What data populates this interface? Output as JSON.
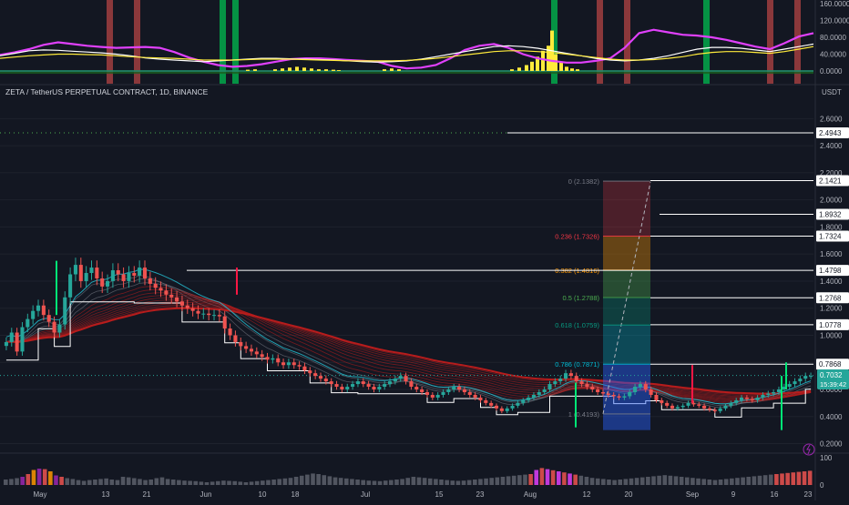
{
  "header": {
    "symbol_title": "ZETA / TetherUS PERPETUAL CONTRACT, 1D, BINANCE",
    "currency": "USDT",
    "current_price": "0.7032",
    "countdown": "15:39:42"
  },
  "colors": {
    "background": "#131722",
    "up_candle": "#26a69a",
    "down_candle": "#ef5350",
    "ribbon": "#b71c1c",
    "oscillator_fast": "#e040fb",
    "oscillator_slow": "#ffeb3b",
    "accent": "#2962ff"
  },
  "chart_data": [
    {
      "type": "oscillator",
      "y_ticks": [
        "160.0000",
        "120.0000",
        "80.0000",
        "40.0000",
        "0.0000"
      ],
      "ylim": [
        0,
        160
      ],
      "series": [
        {
          "values": [
            38,
            44,
            52,
            62,
            68,
            64,
            60,
            57,
            55,
            56,
            57,
            55,
            45,
            32,
            22,
            14,
            10,
            12,
            16,
            22,
            28,
            30,
            30,
            28,
            26,
            24,
            22,
            12,
            6,
            8,
            14,
            30,
            50,
            60,
            64,
            55,
            40,
            30,
            24,
            20,
            20,
            24,
            30,
            55,
            90,
            98,
            92,
            86,
            84,
            80,
            74,
            66,
            58,
            52,
            66,
            82,
            90
          ]
        },
        {
          "values": [
            36,
            42,
            48,
            50,
            49,
            47,
            45,
            43,
            40,
            36,
            31,
            28,
            26,
            24,
            22,
            24,
            26,
            28,
            30,
            30,
            29,
            28,
            27,
            26,
            24,
            22,
            21,
            22,
            24,
            28,
            34,
            40,
            46,
            52,
            58,
            60,
            58,
            54,
            48,
            42,
            36,
            30,
            26,
            24,
            26,
            30,
            36,
            44,
            52,
            56,
            56,
            54,
            50,
            46,
            52,
            58,
            64
          ]
        },
        {
          "values": [
            30,
            33,
            36,
            38,
            40,
            40,
            39,
            38,
            36,
            34,
            32,
            31,
            30,
            28,
            26,
            26,
            26,
            27,
            28,
            28,
            28,
            27,
            26,
            25,
            24,
            24,
            24,
            24,
            25,
            27,
            30,
            34,
            38,
            42,
            46,
            48,
            48,
            46,
            44,
            40,
            36,
            32,
            28,
            26,
            26,
            27,
            30,
            34,
            40,
            44,
            46,
            46,
            44,
            42,
            46,
            52,
            58
          ]
        }
      ]
    },
    {
      "type": "candlestick",
      "x_ticks": [
        "May",
        "13",
        "21",
        "Jun",
        "10",
        "18",
        "Jul",
        "15",
        "23",
        "Aug",
        "12",
        "20",
        "Sep",
        "9",
        "16",
        "23"
      ],
      "y_ticks": [
        "2.6000",
        "2.4000",
        "2.2000",
        "2.0000",
        "1.8000",
        "1.6000",
        "1.4000",
        "1.2000",
        "1.0000",
        "0.8000",
        "0.6000",
        "0.4000",
        "0.2000"
      ],
      "ylim": [
        0.15,
        2.75
      ],
      "close": [
        0.95,
        1.02,
        0.88,
        1.06,
        1.12,
        1.18,
        1.22,
        1.15,
        1.1,
        1.02,
        1.08,
        1.28,
        1.45,
        1.52,
        1.4,
        1.46,
        1.5,
        1.42,
        1.36,
        1.4,
        1.48,
        1.45,
        1.4,
        1.46,
        1.44,
        1.5,
        1.42,
        1.38,
        1.35,
        1.33,
        1.3,
        1.28,
        1.25,
        1.22,
        1.2,
        1.18,
        1.16,
        1.16,
        1.15,
        1.15,
        1.14,
        1.05,
        1.0,
        0.95,
        0.92,
        0.9,
        0.88,
        0.86,
        0.84,
        0.82,
        0.83,
        0.8,
        0.78,
        0.8,
        0.78,
        0.77,
        0.74,
        0.72,
        0.7,
        0.68,
        0.66,
        0.64,
        0.62,
        0.6,
        0.62,
        0.64,
        0.66,
        0.64,
        0.62,
        0.6,
        0.62,
        0.64,
        0.66,
        0.68,
        0.7,
        0.66,
        0.62,
        0.6,
        0.58,
        0.56,
        0.54,
        0.56,
        0.58,
        0.6,
        0.62,
        0.6,
        0.58,
        0.56,
        0.54,
        0.52,
        0.5,
        0.48,
        0.46,
        0.44,
        0.46,
        0.48,
        0.5,
        0.52,
        0.54,
        0.56,
        0.58,
        0.6,
        0.64,
        0.66,
        0.68,
        0.72,
        0.7,
        0.66,
        0.64,
        0.62,
        0.6,
        0.58,
        0.57,
        0.56,
        0.55,
        0.54,
        0.55,
        0.58,
        0.62,
        0.64,
        0.6,
        0.56,
        0.52,
        0.5,
        0.48,
        0.46,
        0.47,
        0.48,
        0.5,
        0.49,
        0.48,
        0.46,
        0.45,
        0.44,
        0.46,
        0.48,
        0.5,
        0.52,
        0.54,
        0.53,
        0.52,
        0.54,
        0.56,
        0.57,
        0.58,
        0.6,
        0.62,
        0.64,
        0.66,
        0.68,
        0.7,
        0.7
      ]
    },
    {
      "type": "bar",
      "ylim": [
        0,
        110
      ],
      "y_ticks": [
        "100",
        "0"
      ],
      "values": [
        20,
        22,
        25,
        30,
        40,
        55,
        60,
        58,
        50,
        35,
        30,
        25,
        22,
        18,
        15,
        18,
        20,
        22,
        24,
        20,
        18,
        30,
        28,
        25,
        22,
        18,
        20,
        25,
        28,
        22,
        20,
        18,
        16,
        15,
        14,
        12,
        10,
        12,
        14,
        16,
        15,
        14,
        12,
        10,
        12,
        14,
        16,
        18,
        20,
        22,
        24,
        26,
        30,
        34,
        38,
        42,
        40,
        36,
        32,
        28,
        26,
        24,
        22,
        20,
        18,
        16,
        15,
        14,
        16,
        18,
        20,
        22,
        26,
        30,
        28,
        26,
        24,
        22,
        20,
        18,
        16,
        15,
        16,
        18,
        20,
        22,
        24,
        26,
        28,
        30,
        32,
        34,
        36,
        38,
        40,
        55,
        62,
        58,
        54,
        50,
        46,
        42,
        38,
        34,
        30,
        26,
        24,
        22,
        20,
        18,
        20,
        22,
        24,
        26,
        28,
        30,
        32,
        34,
        36,
        34,
        32,
        30,
        28,
        26,
        24,
        22,
        20,
        18,
        20,
        22,
        24,
        26,
        28,
        30,
        32,
        34,
        36,
        38,
        40,
        42,
        44,
        46,
        48,
        50,
        52
      ]
    }
  ],
  "fib": {
    "levels": [
      {
        "label": "0 (2.1382)",
        "value": 2.1382,
        "color": "#787b86"
      },
      {
        "label": "0.236 (1.7326)",
        "value": 1.7326,
        "color": "#f23645"
      },
      {
        "label": "0.382 (1.4816)",
        "value": 1.4816,
        "color": "#ff9800"
      },
      {
        "label": "0.5 (1.2788)",
        "value": 1.2788,
        "color": "#4caf50"
      },
      {
        "label": "0.618 (1.0759)",
        "value": 1.0759,
        "color": "#089981"
      },
      {
        "label": "0.786 (0.7871)",
        "value": 0.7871,
        "color": "#00bcd4"
      },
      {
        "label": "1 (0.4193)",
        "value": 0.4193,
        "color": "#787b86"
      }
    ]
  },
  "price_tags": [
    {
      "label": "2.4943",
      "value": 2.4943
    },
    {
      "label": "2.1421",
      "value": 2.1421
    },
    {
      "label": "1.8932",
      "value": 1.8932
    },
    {
      "label": "1.7324",
      "value": 1.7324
    },
    {
      "label": "1.4798",
      "value": 1.4798
    },
    {
      "label": "1.2768",
      "value": 1.2768
    },
    {
      "label": "1.0778",
      "value": 1.0778
    },
    {
      "label": "0.7868",
      "value": 0.7868
    }
  ]
}
